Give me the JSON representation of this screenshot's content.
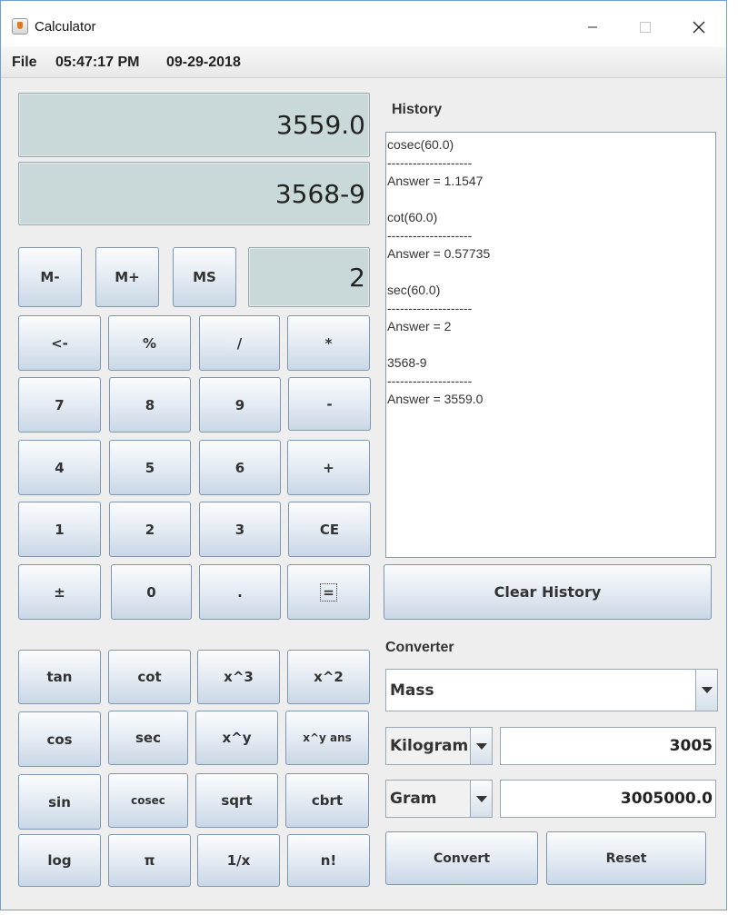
{
  "window": {
    "title": "Calculator"
  },
  "menubar": {
    "file": "File",
    "time": "05:47:17 PM",
    "date": "09-29-2018"
  },
  "display": {
    "result": "3559.0",
    "expression": "3568-9",
    "memory": "2"
  },
  "memory_buttons": {
    "m_minus": "M-",
    "m_plus": "M+",
    "ms": "MS"
  },
  "keypad": {
    "backspace": "<-",
    "percent": "%",
    "divide": "/",
    "multiply": "*",
    "seven": "7",
    "eight": "8",
    "nine": "9",
    "minus": "-",
    "four": "4",
    "five": "5",
    "six": "6",
    "plus": "+",
    "one": "1",
    "two": "2",
    "three": "3",
    "ce": "CE",
    "plusminus": "±",
    "zero": "0",
    "dot": ".",
    "equals": "="
  },
  "scientific": {
    "tan": "tan",
    "cot": "cot",
    "cube": "x^3",
    "square": "x^2",
    "cos": "cos",
    "sec": "sec",
    "pow": "x^y",
    "pow_ans": "x^y ans",
    "sin": "sin",
    "cosec": "cosec",
    "sqrt": "sqrt",
    "cbrt": "cbrt",
    "log": "log",
    "pi": "π",
    "reciprocal": "1/x",
    "factorial": "n!"
  },
  "history": {
    "label": "History",
    "lines": [
      "cosec(60.0)",
      "--------------------",
      "Answer = 1.1547",
      "",
      "cot(60.0)",
      "--------------------",
      "Answer = 0.57735",
      "",
      "sec(60.0)",
      "--------------------",
      "Answer = 2",
      "",
      "3568-9",
      "--------------------",
      "Answer = 3559.0"
    ],
    "clear_label": "Clear History"
  },
  "converter": {
    "label": "Converter",
    "category": "Mass",
    "from_unit": "Kilogram",
    "from_value": "3005",
    "to_unit": "Gram",
    "to_value": "3005000.0",
    "convert_label": "Convert",
    "reset_label": "Reset"
  }
}
